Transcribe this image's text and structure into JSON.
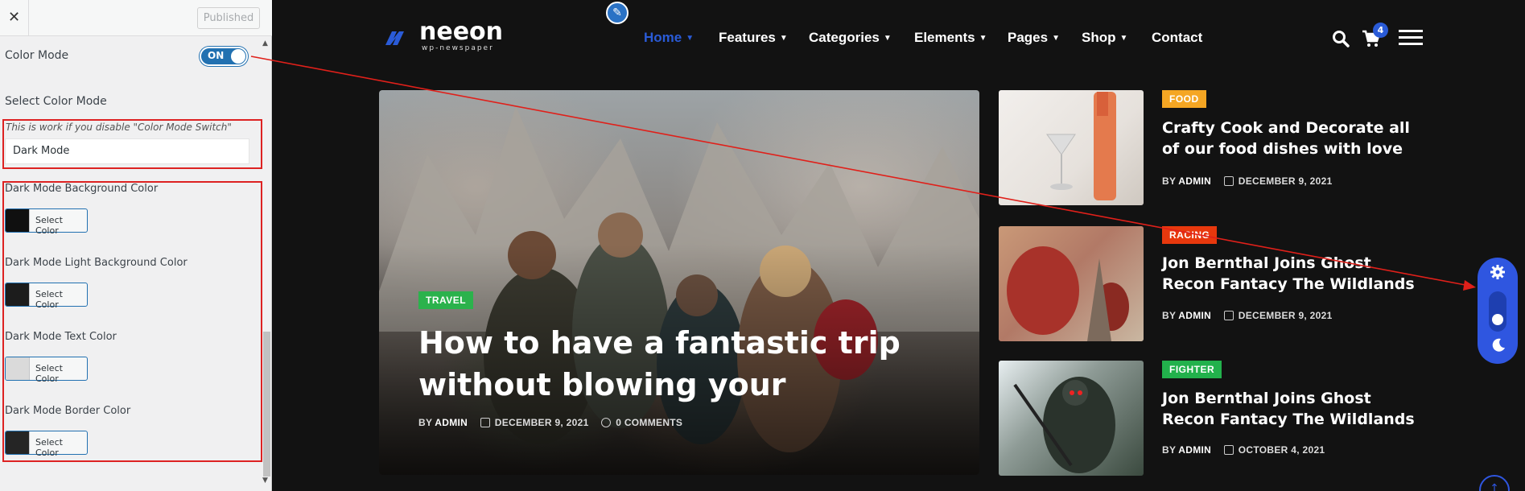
{
  "panel": {
    "close_glyph": "✕",
    "published_label": "Published",
    "color_mode_label": "Color Mode",
    "toggle_label": "ON",
    "select_mode_label": "Select Color Mode",
    "hint": "This is work if you disable \"Color Mode Switch\"",
    "mode_value": "Dark Mode",
    "colors": [
      {
        "label": "Dark Mode Background Color",
        "button": "Select Color",
        "swatch": "#101010"
      },
      {
        "label": "Dark Mode Light Background Color",
        "button": "Select Color",
        "swatch": "#1c1c1c"
      },
      {
        "label": "Dark Mode Text Color",
        "button": "Select Color",
        "swatch": "#dadada"
      },
      {
        "label": "Dark Mode Border Color",
        "button": "Select Color",
        "swatch": "#252525"
      }
    ]
  },
  "site": {
    "logo_text": "neeon",
    "logo_sub": "wp-newspaper",
    "nav": [
      "Home",
      "Features",
      "Categories",
      "Elements",
      "Pages",
      "Shop",
      "Contact"
    ],
    "cart_count": "4",
    "accent": "#2a5bd7",
    "hero": {
      "category": "TRAVEL",
      "title": "How to have a fantastic trip without blowing your",
      "by": "BY",
      "author": "ADMIN",
      "date": "DECEMBER 9, 2021",
      "comments": "0 COMMENTS"
    },
    "posts": [
      {
        "category": "FOOD",
        "color": "#f5a623",
        "title": "Crafty Cook and Decorate all of our food dishes with love",
        "by": "BY",
        "author": "ADMIN",
        "date": "DECEMBER 9, 2021"
      },
      {
        "category": "RACING",
        "color": "#e8380d",
        "title": "Jon Bernthal Joins Ghost Recon Fantacy The Wildlands",
        "by": "BY",
        "author": "ADMIN",
        "date": "DECEMBER 9, 2021"
      },
      {
        "category": "FIGHTER",
        "color": "#22b14c",
        "title": "Jon Bernthal Joins Ghost Recon Fantacy The Wildlands",
        "by": "BY",
        "author": "ADMIN",
        "date": "OCTOBER 4, 2021"
      }
    ]
  },
  "icons": [
    "close-icon",
    "pencil-icon",
    "search-icon",
    "cart-icon",
    "hamburger-icon",
    "gear-icon",
    "moon-icon",
    "calendar-icon",
    "comment-icon",
    "arrow-up-icon"
  ]
}
